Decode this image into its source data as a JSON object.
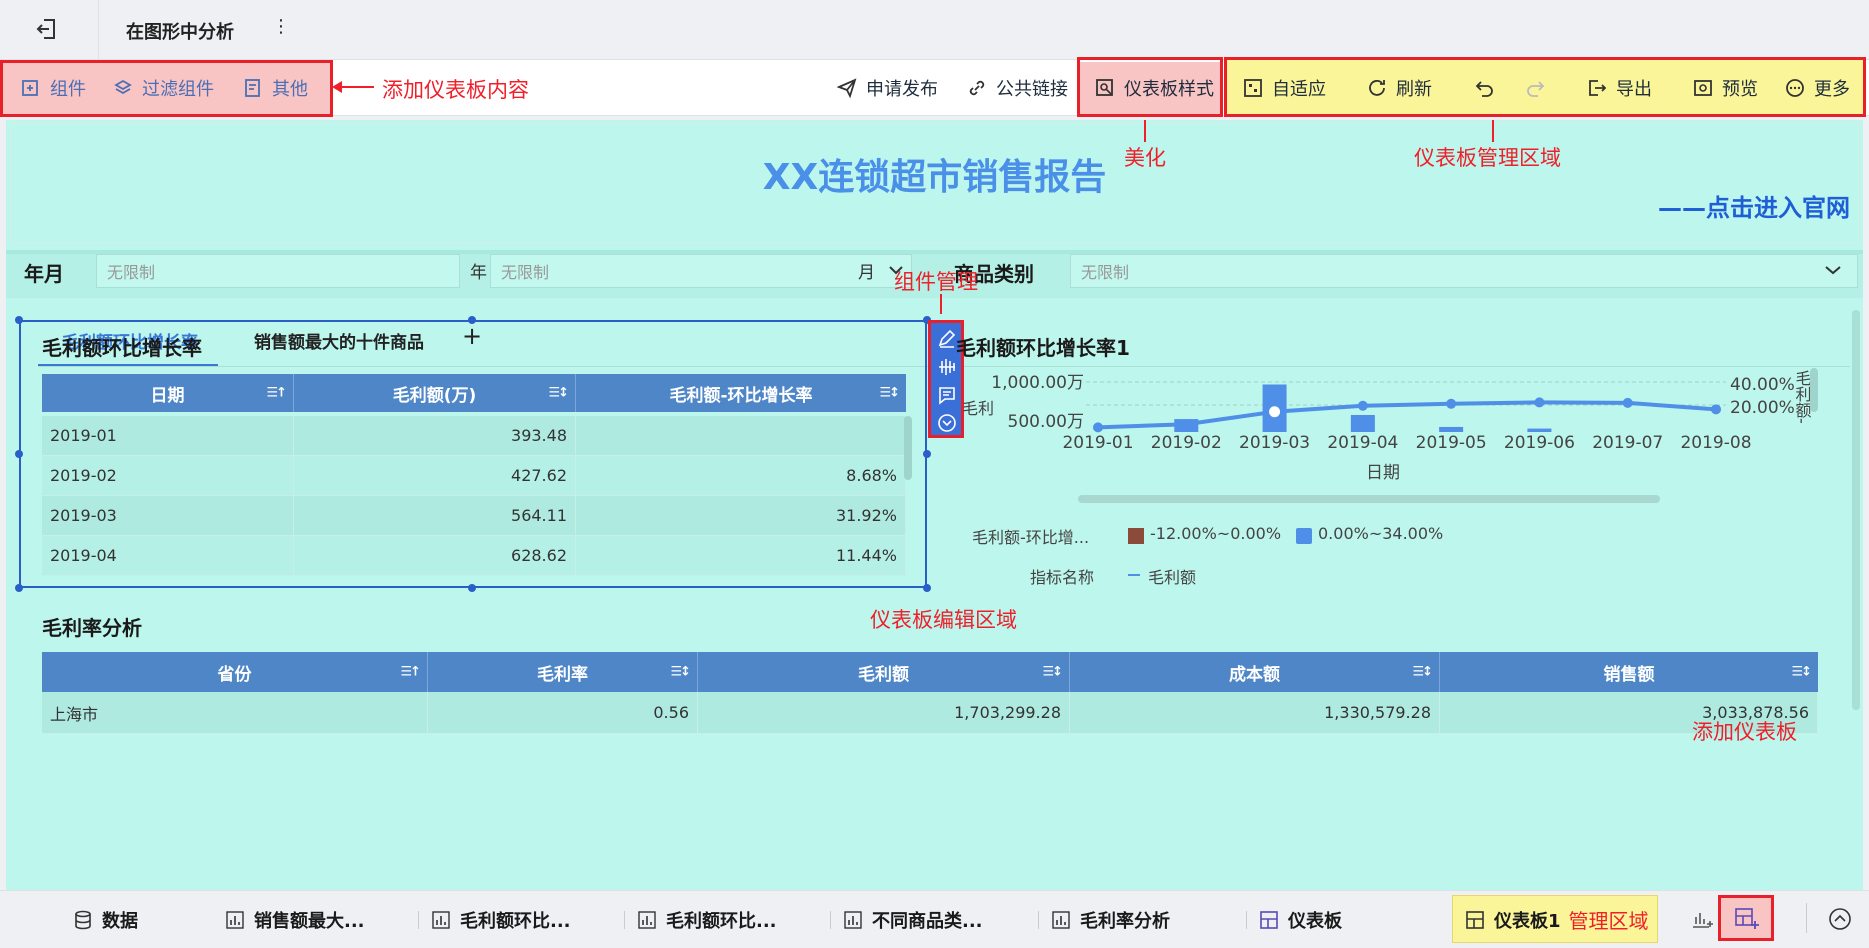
{
  "topbar": {
    "title": "在图形中分析",
    "more": "⋮"
  },
  "toolbar": {
    "left": [
      {
        "label": "组件",
        "icon": "add-component-icon"
      },
      {
        "label": "过滤组件",
        "icon": "filter-component-icon"
      },
      {
        "label": "其他",
        "icon": "other-icon"
      }
    ],
    "publish": "申请发布",
    "public_link": "公共链接",
    "style": "仪表板样式",
    "right": [
      {
        "label": "自适应"
      },
      {
        "label": "刷新"
      },
      {
        "label": "导出"
      },
      {
        "label": "预览"
      },
      {
        "label": "更多"
      }
    ]
  },
  "annotations": {
    "add_content": "添加仪表板内容",
    "beautify": "美化",
    "manage_area": "仪表板管理区域",
    "component_manage": "组件管理",
    "edit_area": "仪表板编辑区域",
    "add_dashboard": "添加仪表板",
    "dashboard_manage": "管理区域"
  },
  "report": {
    "title": "XX连锁超市销售报告",
    "link": "——点击进入官网"
  },
  "filters": {
    "yearmonth_label": "年月",
    "placeholder": "无限制",
    "year_suffix": "年",
    "month_suffix": "月",
    "category_label": "商品类别"
  },
  "tabs": [
    "毛利额环比增长率",
    "销售额最大的十件商品",
    "+"
  ],
  "table1": {
    "title": "毛利额环比增长率",
    "headers": [
      "日期",
      "毛利额(万)",
      "毛利额-环比增长率"
    ],
    "rows": [
      [
        "2019-01",
        "393.48",
        ""
      ],
      [
        "2019-02",
        "427.62",
        "8.68%"
      ],
      [
        "2019-03",
        "564.11",
        "31.92%"
      ],
      [
        "2019-04",
        "628.62",
        "11.44%"
      ]
    ]
  },
  "chart_data": {
    "type": "line",
    "title": "毛利额环比增长率1",
    "xlabel": "日期",
    "ylabel_left": "毛利",
    "ylabel_right": "毛利额-",
    "y_ticks_left": [
      "1,000.00万",
      "500.00万"
    ],
    "y_ticks_right": [
      "40.00%",
      "20.00%"
    ],
    "categories": [
      "2019-01",
      "2019-02",
      "2019-03",
      "2019-04",
      "2019-05",
      "2019-06",
      "2019-07",
      "2019-08"
    ],
    "series": [
      {
        "name": "毛利额",
        "type": "line",
        "values": [
          393.48,
          427.62,
          564.11,
          628.62,
          650,
          665,
          660,
          590
        ]
      },
      {
        "name": "毛利额-环比增长率",
        "type": "bar",
        "values": [
          0,
          8.68,
          31.92,
          11.44,
          3.4,
          2.3,
          -0.8,
          -10.6
        ]
      }
    ],
    "ylim_left": [
      0,
      1000
    ],
    "legend": [
      {
        "label": "毛利额-环比增...",
        "items": [
          {
            "text": "-12.00%~0.00%",
            "color": "#8b4a3a"
          },
          {
            "text": "0.00%~34.00%",
            "color": "#4f8fe8"
          }
        ]
      },
      {
        "label": "指标名称",
        "items": [
          {
            "text": "毛利额",
            "color": "#4f8fe8"
          }
        ]
      }
    ]
  },
  "table2": {
    "title": "毛利率分析",
    "headers": [
      "省份",
      "毛利率",
      "毛利额",
      "成本额",
      "销售额"
    ],
    "rows": [
      [
        "上海市",
        "0.56",
        "1,703,299.28",
        "1,330,579.28",
        "3,033,878.56"
      ]
    ]
  },
  "bottom": {
    "data": "数据",
    "tabs": [
      "销售额最大...",
      "毛利额环比...",
      "毛利额环比...",
      "不同商品类...",
      "毛利率分析",
      "仪表板"
    ],
    "active": "仪表板1"
  },
  "colors": {
    "canvas": "#bdf6ec",
    "header": "#4e86c8",
    "accent": "#4a8fe8",
    "annotation": "#f0202a"
  }
}
